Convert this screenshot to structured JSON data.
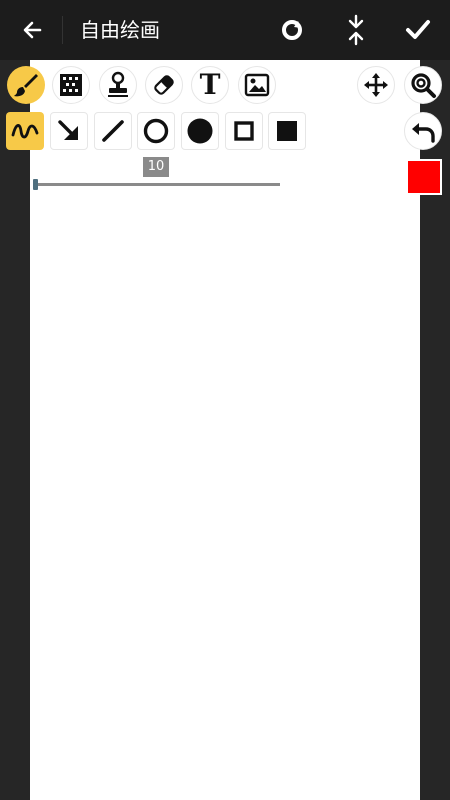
{
  "header": {
    "title": "自由绘画",
    "back_icon": "arrow-left-icon",
    "rotate_icon": "rotate-icon",
    "compress_icon": "compress-icon",
    "confirm_icon": "check-icon"
  },
  "tools_row1": [
    {
      "name": "brush",
      "icon": "brush-icon",
      "active": true
    },
    {
      "name": "mosaic",
      "icon": "mosaic-icon",
      "active": false
    },
    {
      "name": "stamp",
      "icon": "stamp-icon",
      "active": false
    },
    {
      "name": "eraser",
      "icon": "eraser-icon",
      "active": false
    },
    {
      "name": "text",
      "icon": "text-icon",
      "label": "T",
      "active": false
    },
    {
      "name": "image",
      "icon": "image-icon",
      "active": false
    }
  ],
  "tools_row2": [
    {
      "name": "freehand",
      "icon": "wave-icon",
      "active": true
    },
    {
      "name": "arrow",
      "icon": "arrow-diagonal-icon",
      "active": false
    },
    {
      "name": "line",
      "icon": "line-icon",
      "active": false
    },
    {
      "name": "circle-outline",
      "icon": "circle-outline-icon",
      "active": false
    },
    {
      "name": "circle-filled",
      "icon": "circle-filled-icon",
      "active": false
    },
    {
      "name": "square-outline",
      "icon": "square-outline-icon",
      "active": false
    },
    {
      "name": "square-filled",
      "icon": "square-filled-icon",
      "active": false
    }
  ],
  "right_controls": {
    "move_icon": "move-icon",
    "zoom_icon": "zoom-icon",
    "undo_icon": "undo-icon"
  },
  "brush_size": {
    "label": "10",
    "value": 10,
    "fraction": 0.0
  },
  "colors": {
    "current_color": "#ff0000",
    "accent": "#f7c948"
  }
}
